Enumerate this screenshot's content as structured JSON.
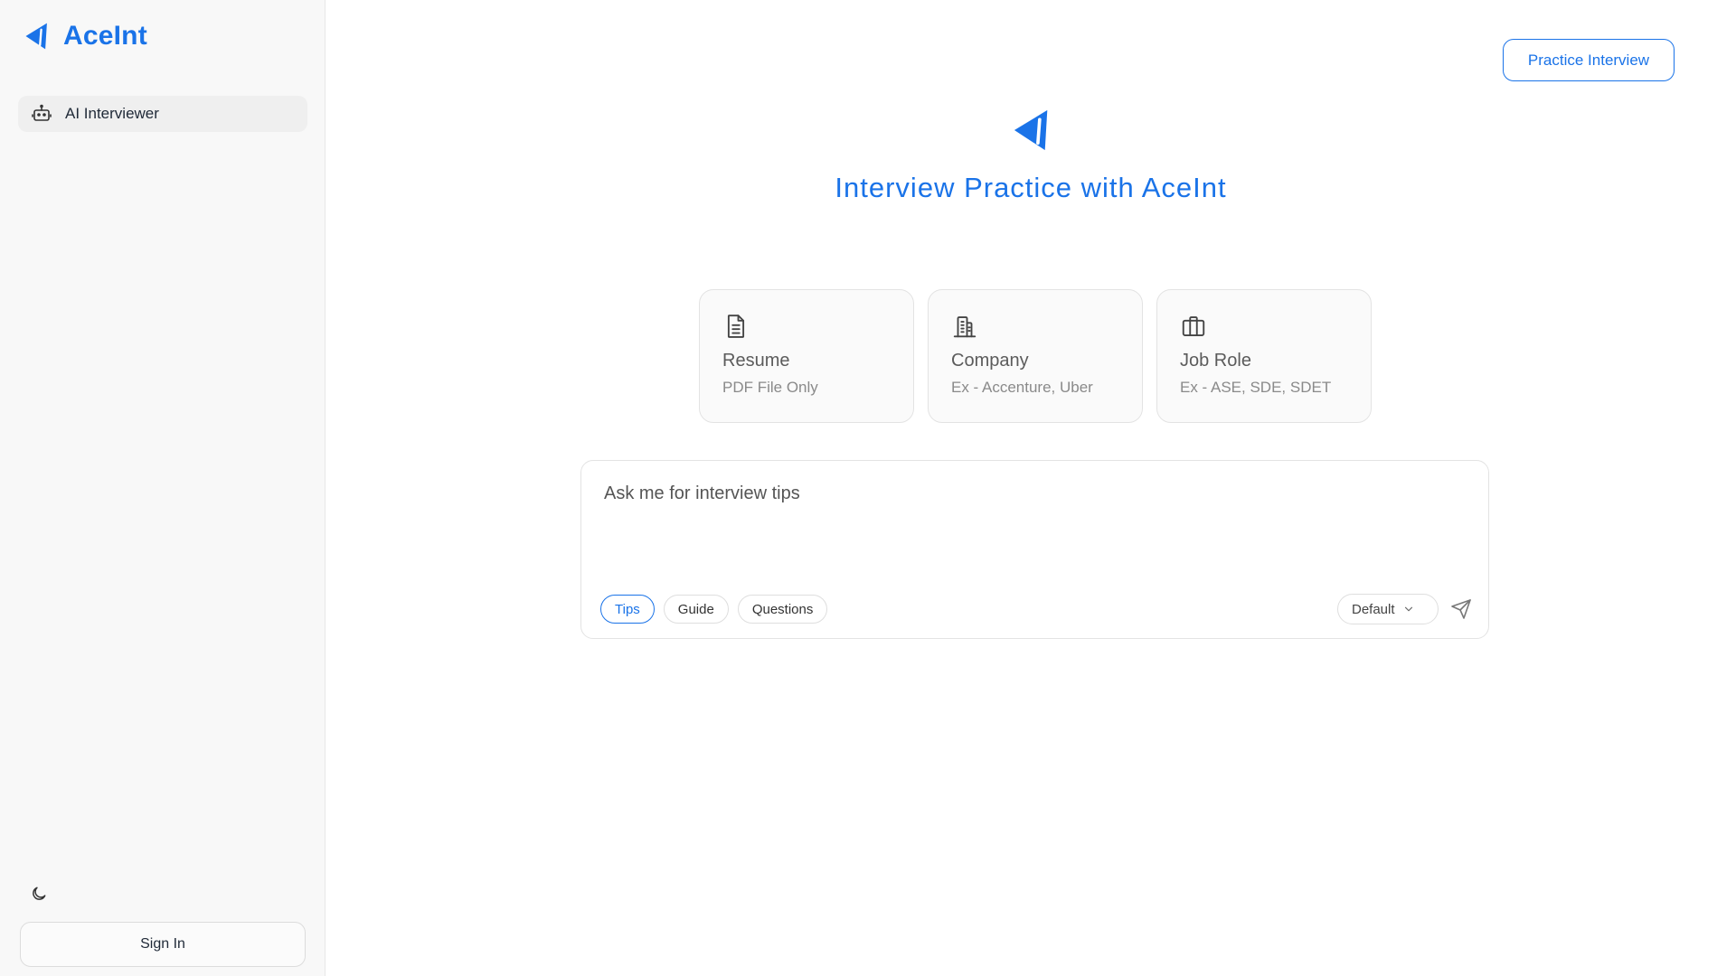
{
  "brand": {
    "name": "AceInt"
  },
  "sidebar": {
    "items": [
      {
        "label": "AI Interviewer",
        "icon": "robot-icon"
      }
    ],
    "theme_icon": "moon-icon",
    "signin_label": "Sign In"
  },
  "header": {
    "practice_button": "Practice Interview"
  },
  "hero": {
    "title": "Interview Practice with AceInt",
    "icon": "aceint-logo-icon"
  },
  "cards": [
    {
      "title": "Resume",
      "subtitle": "PDF File Only",
      "icon": "document-icon"
    },
    {
      "title": "Company",
      "subtitle": "Ex - Accenture, Uber",
      "icon": "building-icon"
    },
    {
      "title": "Job Role",
      "subtitle": "Ex - ASE, SDE, SDET",
      "icon": "briefcase-icon"
    }
  ],
  "composer": {
    "placeholder": "Ask me for interview tips",
    "chips": [
      {
        "label": "Tips",
        "active": true
      },
      {
        "label": "Guide",
        "active": false
      },
      {
        "label": "Questions",
        "active": false
      }
    ],
    "mode": "Default",
    "send_icon": "send-icon"
  },
  "colors": {
    "accent": "#1a73e8",
    "sidebar_bg": "#f8f8f8"
  }
}
